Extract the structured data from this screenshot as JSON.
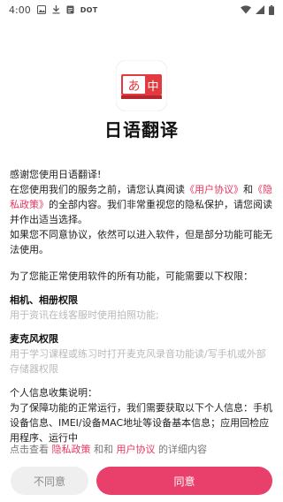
{
  "status_bar": {
    "time": "4:00",
    "indicator_label": "DOT",
    "icons": [
      "image-icon",
      "download-icon",
      "doc-icon",
      "wifi-icon",
      "signal-icon",
      "battery-icon"
    ]
  },
  "app": {
    "title": "日语翻译",
    "logo": {
      "left_glyph": "あ",
      "right_glyph": "中",
      "bg_color": "#e23a3f"
    }
  },
  "privacy": {
    "greeting": "感谢您使用日语翻译!",
    "intro_before": "在您使用我们的服务之前，请您认真阅读",
    "user_agreement_link": "《用户协议》",
    "and_text": "和",
    "privacy_link": "《隐私政策》",
    "intro_after": "的全部内容。我们非常重视您的隐私保护，请您阅读并作出适当选择。",
    "disagree_note": "如果您不同意协议，依然可以进入软件，但是部分功能可能无法使用。",
    "permission_intro": "为了您能正常使用软件的所有功能，可能需要以下权限：",
    "permissions": [
      {
        "title": "相机、相册权限",
        "desc": "用于资讯在线客服时使用拍照功能;"
      },
      {
        "title": "麦克风权限",
        "desc": "用于学习课程或练习时打开麦克风录音功能读/写手机或外部存储器权限"
      }
    ],
    "collection_title": "个人信息收集说明：",
    "collection_text": "为了保障功能的正常运行，我们需要获取以下个人信息：手机设备信息、IMEI/设备MAC地址等设备基本信息；应用回检应用程序、运行中"
  },
  "footer": {
    "note_prefix": "点击查看",
    "privacy_link": "隐私政策",
    "and_text": "和和",
    "user_link": "用户协议",
    "note_suffix": "的详细内容"
  },
  "buttons": {
    "disagree": "不同意",
    "agree": "同意"
  },
  "colors": {
    "accent": "#e9406b",
    "link": "#e8355f",
    "hint": "#b9b9b9",
    "disagree_bg": "#efefef"
  }
}
